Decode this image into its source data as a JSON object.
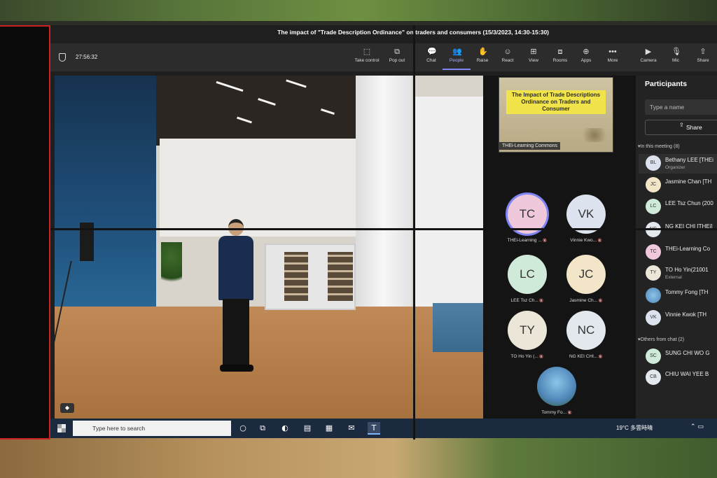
{
  "meeting": {
    "title": "The impact of \"Trade Description Ordinance\" on traders and consumers (15/3/2023, 14:30-15:30)",
    "timer": "27:56:32"
  },
  "toolbar": {
    "take_control": "Take control",
    "pop_out": "Pop out",
    "chat": "Chat",
    "people": "People",
    "raise": "Raise",
    "react": "React",
    "view": "View",
    "rooms": "Rooms",
    "apps": "Apps",
    "more": "More",
    "camera": "Camera",
    "mic": "Mic",
    "share": "Share"
  },
  "slide": {
    "title": "The Impact of Trade Descriptions Ordinance on Traders and Consumer",
    "presenter_label": "THEi-Learning Commons"
  },
  "tiles": [
    {
      "initials": "TC",
      "name": "THEi-Learning ...",
      "color": "#f0c8dc"
    },
    {
      "initials": "VK",
      "name": "Vinnie Kwo...",
      "color": "#dde3ee"
    },
    {
      "initials": "LC",
      "name": "LEE Tsz Ch...",
      "color": "#cfead8"
    },
    {
      "initials": "JC",
      "name": "Jasmine Ch...",
      "color": "#f3e6c8"
    },
    {
      "initials": "TY",
      "name": "TO Ho Yin (...",
      "color": "#ece6d8"
    },
    {
      "initials": "NC",
      "name": "NG KEI CHI...",
      "color": "#e3e8ef"
    },
    {
      "initials": "",
      "name": "Tommy Fo...",
      "color": "#6aa3d4"
    }
  ],
  "participants": {
    "title": "Participants",
    "search_placeholder": "Type a name",
    "share_label": "Share",
    "in_meeting_label": "In this meeting (8)",
    "in_meeting": [
      {
        "initials": "BL",
        "name": "Bethany LEE [THEi",
        "role": "Organizer",
        "color": "#dde3ee"
      },
      {
        "initials": "JC",
        "name": "Jasmine Chan [TH",
        "role": "",
        "color": "#f3e6c8"
      },
      {
        "initials": "LC",
        "name": "LEE Tsz Chun (200",
        "role": "",
        "color": "#cfead8"
      },
      {
        "initials": "NC",
        "name": "NG KEI CHI [THEi]",
        "role": "",
        "color": "#e3e8ef"
      },
      {
        "initials": "TC",
        "name": "THEi-Learning Co",
        "role": "",
        "color": "#f0c8dc"
      },
      {
        "initials": "TY",
        "name": "TO Ho Yin(21001",
        "role": "External",
        "color": "#ece6d8"
      },
      {
        "initials": "",
        "name": "Tommy Fong [TH",
        "role": "",
        "color": "#6aa3d4"
      },
      {
        "initials": "VK",
        "name": "Vinnie Kwok [TH",
        "role": "",
        "color": "#dde3ee"
      }
    ],
    "others_label": "Others from chat (2)",
    "others": [
      {
        "initials": "SC",
        "name": "SUNG CHI WO G",
        "color": "#cfead8"
      },
      {
        "initials": "CB",
        "name": "CHIU WAI YEE B",
        "color": "#e3e8ef"
      }
    ]
  },
  "taskbar": {
    "search_placeholder": "Type here to search",
    "weather": "19°C 多雲時晴"
  }
}
